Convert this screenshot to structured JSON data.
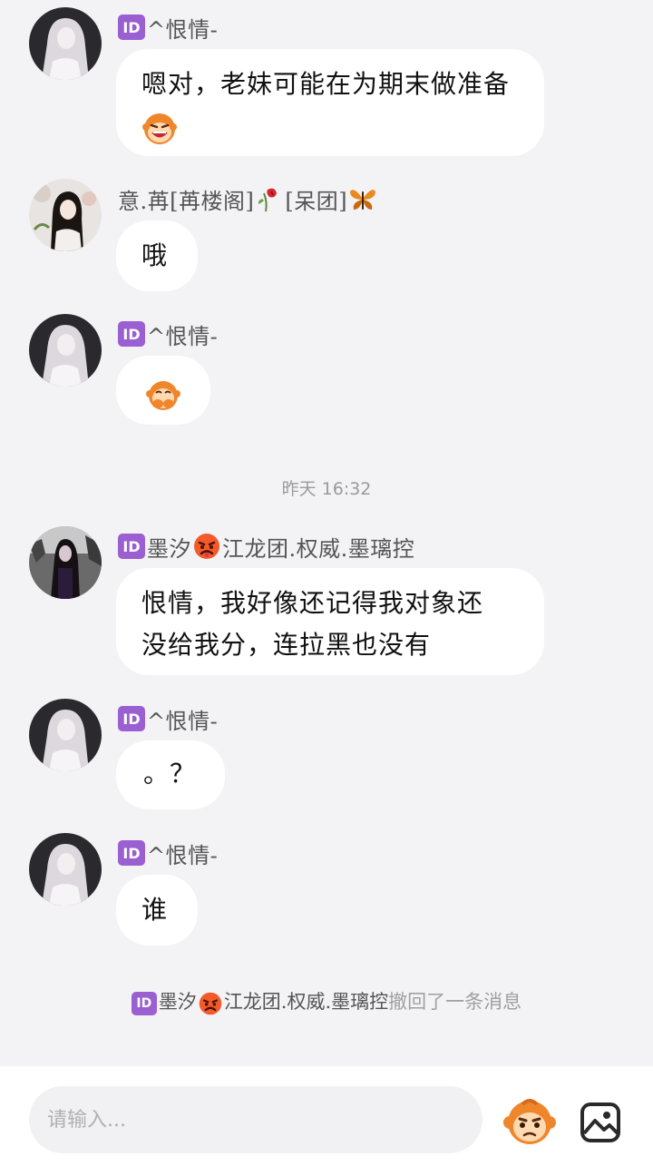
{
  "messages": [
    {
      "sender": "^恨情-",
      "has_id_badge": true,
      "avatar": "white-haired-doll-avatar",
      "text": "嗯对，老妹可能在为期末做准备",
      "trailing_emoji": "laughing-monkey-emoji"
    },
    {
      "sender_parts": [
        "意.苒[苒楼阁]",
        "[呆团]"
      ],
      "sender_emojis": [
        "wilted-rose-emoji",
        "butterfly-emoji"
      ],
      "has_id_badge": false,
      "avatar": "girl-with-flowers-avatar",
      "text": "哦"
    },
    {
      "sender": "^恨情-",
      "has_id_badge": true,
      "avatar": "white-haired-doll-avatar",
      "text": "",
      "only_emoji": "covering-mouth-monkey-emoji"
    },
    {
      "sender_parts": [
        "墨汐",
        "江龙团.权威.墨璃控"
      ],
      "sender_emojis": [
        "angry-red-face-emoji"
      ],
      "has_id_badge": true,
      "avatar": "dark-haired-girl-avatar",
      "text_lines": [
        "恨情，我好像还记得我对象还",
        "没给我分，连拉黑也没有"
      ]
    },
    {
      "sender": "^恨情-",
      "has_id_badge": true,
      "avatar": "white-haired-doll-avatar",
      "text": "。？"
    },
    {
      "sender": "^恨情-",
      "has_id_badge": true,
      "avatar": "white-haired-doll-avatar",
      "text": "谁"
    }
  ],
  "id_badge_label": "ID",
  "timestamp": {
    "day": "昨天",
    "time": "16:32"
  },
  "recall_notice": {
    "who_part1": "墨汐",
    "who_part2": "江龙团.权威.墨璃控",
    "action": "撤回了一条消息",
    "emoji": "angry-red-face-emoji"
  },
  "composer": {
    "placeholder": "请输入...",
    "emoji_button": "monkey-emoji-picker-icon",
    "image_button": "image-icon"
  },
  "colors": {
    "background": "#f3f3f6",
    "bubble": "#ffffff",
    "id_badge": "#9a5fd0",
    "muted_text": "#9a9a9a"
  }
}
